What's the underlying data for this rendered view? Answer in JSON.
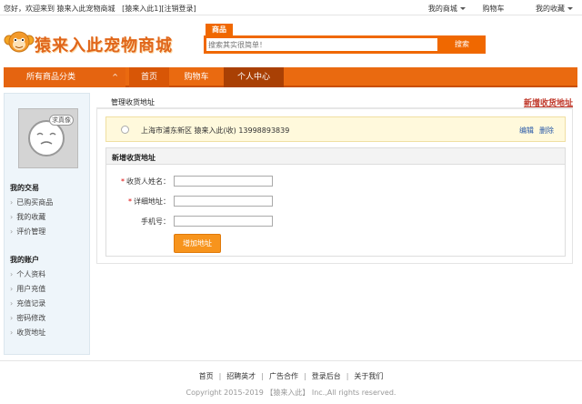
{
  "topbar": {
    "welcome": "您好，欢迎来到 猿来入此宠物商城",
    "user": "[猿来入此1][",
    "logout": "注销登录",
    "close_bracket": "]",
    "my_mall": "我的商城",
    "cart": "购物车",
    "favorites": "我的收藏"
  },
  "header": {
    "logo_text": "猿来入此宠物商城",
    "search_tab": "商品",
    "search_placeholder": "搜索其实很简单！",
    "search_button": "搜索"
  },
  "nav": {
    "all_categories": "所有商品分类",
    "up_arrow": "^",
    "home": "首页",
    "cart": "购物车",
    "user_center": "个人中心"
  },
  "sidebar": {
    "avatar_tag": "求真像",
    "trade_title": "我的交易",
    "trade_items": [
      "已购买商品",
      "我的收藏",
      "评价管理"
    ],
    "account_title": "我的账户",
    "account_items": [
      "个人资料",
      "用户充值",
      "充值记录",
      "密码修改",
      "收货地址"
    ]
  },
  "main": {
    "title": "管理收货地址",
    "add_link": "新增收货地址",
    "address": {
      "text": "上海市浦东新区  猿来入此(收)  13998893839",
      "edit": "编辑",
      "delete": "删除"
    },
    "form": {
      "title": "新增收货地址",
      "name_label": "收货人姓名：",
      "address_label": "详细地址：",
      "phone_label": "手机号：",
      "required_mark": "*",
      "submit": "增加地址"
    }
  },
  "footer": {
    "links": [
      "首页",
      "招聘英才",
      "广告合作",
      "登录后台",
      "关于我们"
    ],
    "separator": "|",
    "copyright": "Copyright 2015-2019 【猿来入此】 Inc.,All rights reserved."
  },
  "colors": {
    "accent": "#ea6a10",
    "button": "#f7941d",
    "link_red": "#c0392b"
  }
}
